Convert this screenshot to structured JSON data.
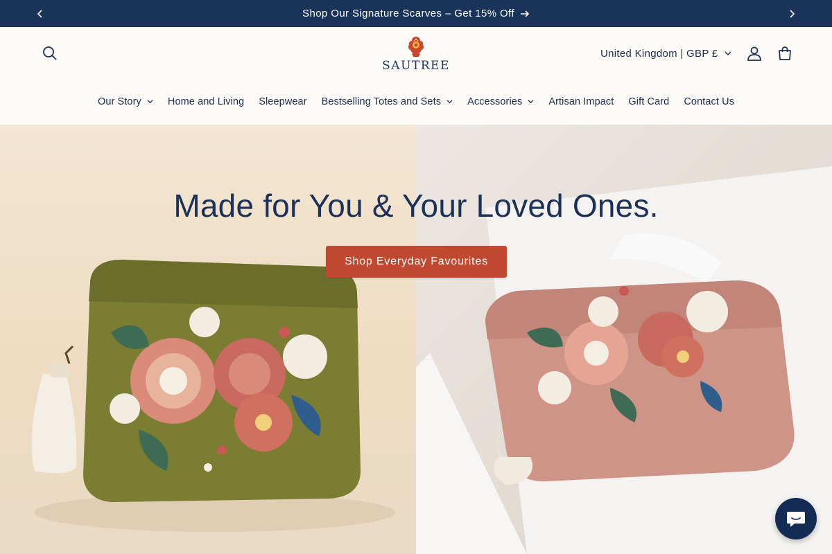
{
  "announcement": {
    "text": "Shop Our Signature Scarves – Get 15% Off",
    "prev_icon": "chevron-left-icon",
    "next_icon": "chevron-right-icon",
    "arrow_icon": "arrow-right-icon"
  },
  "header": {
    "logo_text": "SAUTREE",
    "country_selector": "United Kingdom | GBP £",
    "icons": [
      "search-icon",
      "account-icon",
      "cart-icon"
    ]
  },
  "nav": {
    "items": [
      {
        "label": "Our Story",
        "has_dropdown": true
      },
      {
        "label": "Home and Living",
        "has_dropdown": false
      },
      {
        "label": "Sleepwear",
        "has_dropdown": false
      },
      {
        "label": "Bestselling Totes and Sets",
        "has_dropdown": true
      },
      {
        "label": "Accessories",
        "has_dropdown": true
      },
      {
        "label": "Artisan Impact",
        "has_dropdown": false
      },
      {
        "label": "Gift Card",
        "has_dropdown": false
      },
      {
        "label": "Contact Us",
        "has_dropdown": false
      }
    ]
  },
  "hero": {
    "title": "Made for You & Your Loved Ones.",
    "cta_label": "Shop Everyday Favourites"
  },
  "chat": {
    "icon": "chat-icon"
  },
  "colors": {
    "announcement_bg": "#1a3358",
    "brand_navy": "#1c2d4f",
    "cta": "#bf4a31",
    "page_bg": "#fdfbf7"
  }
}
